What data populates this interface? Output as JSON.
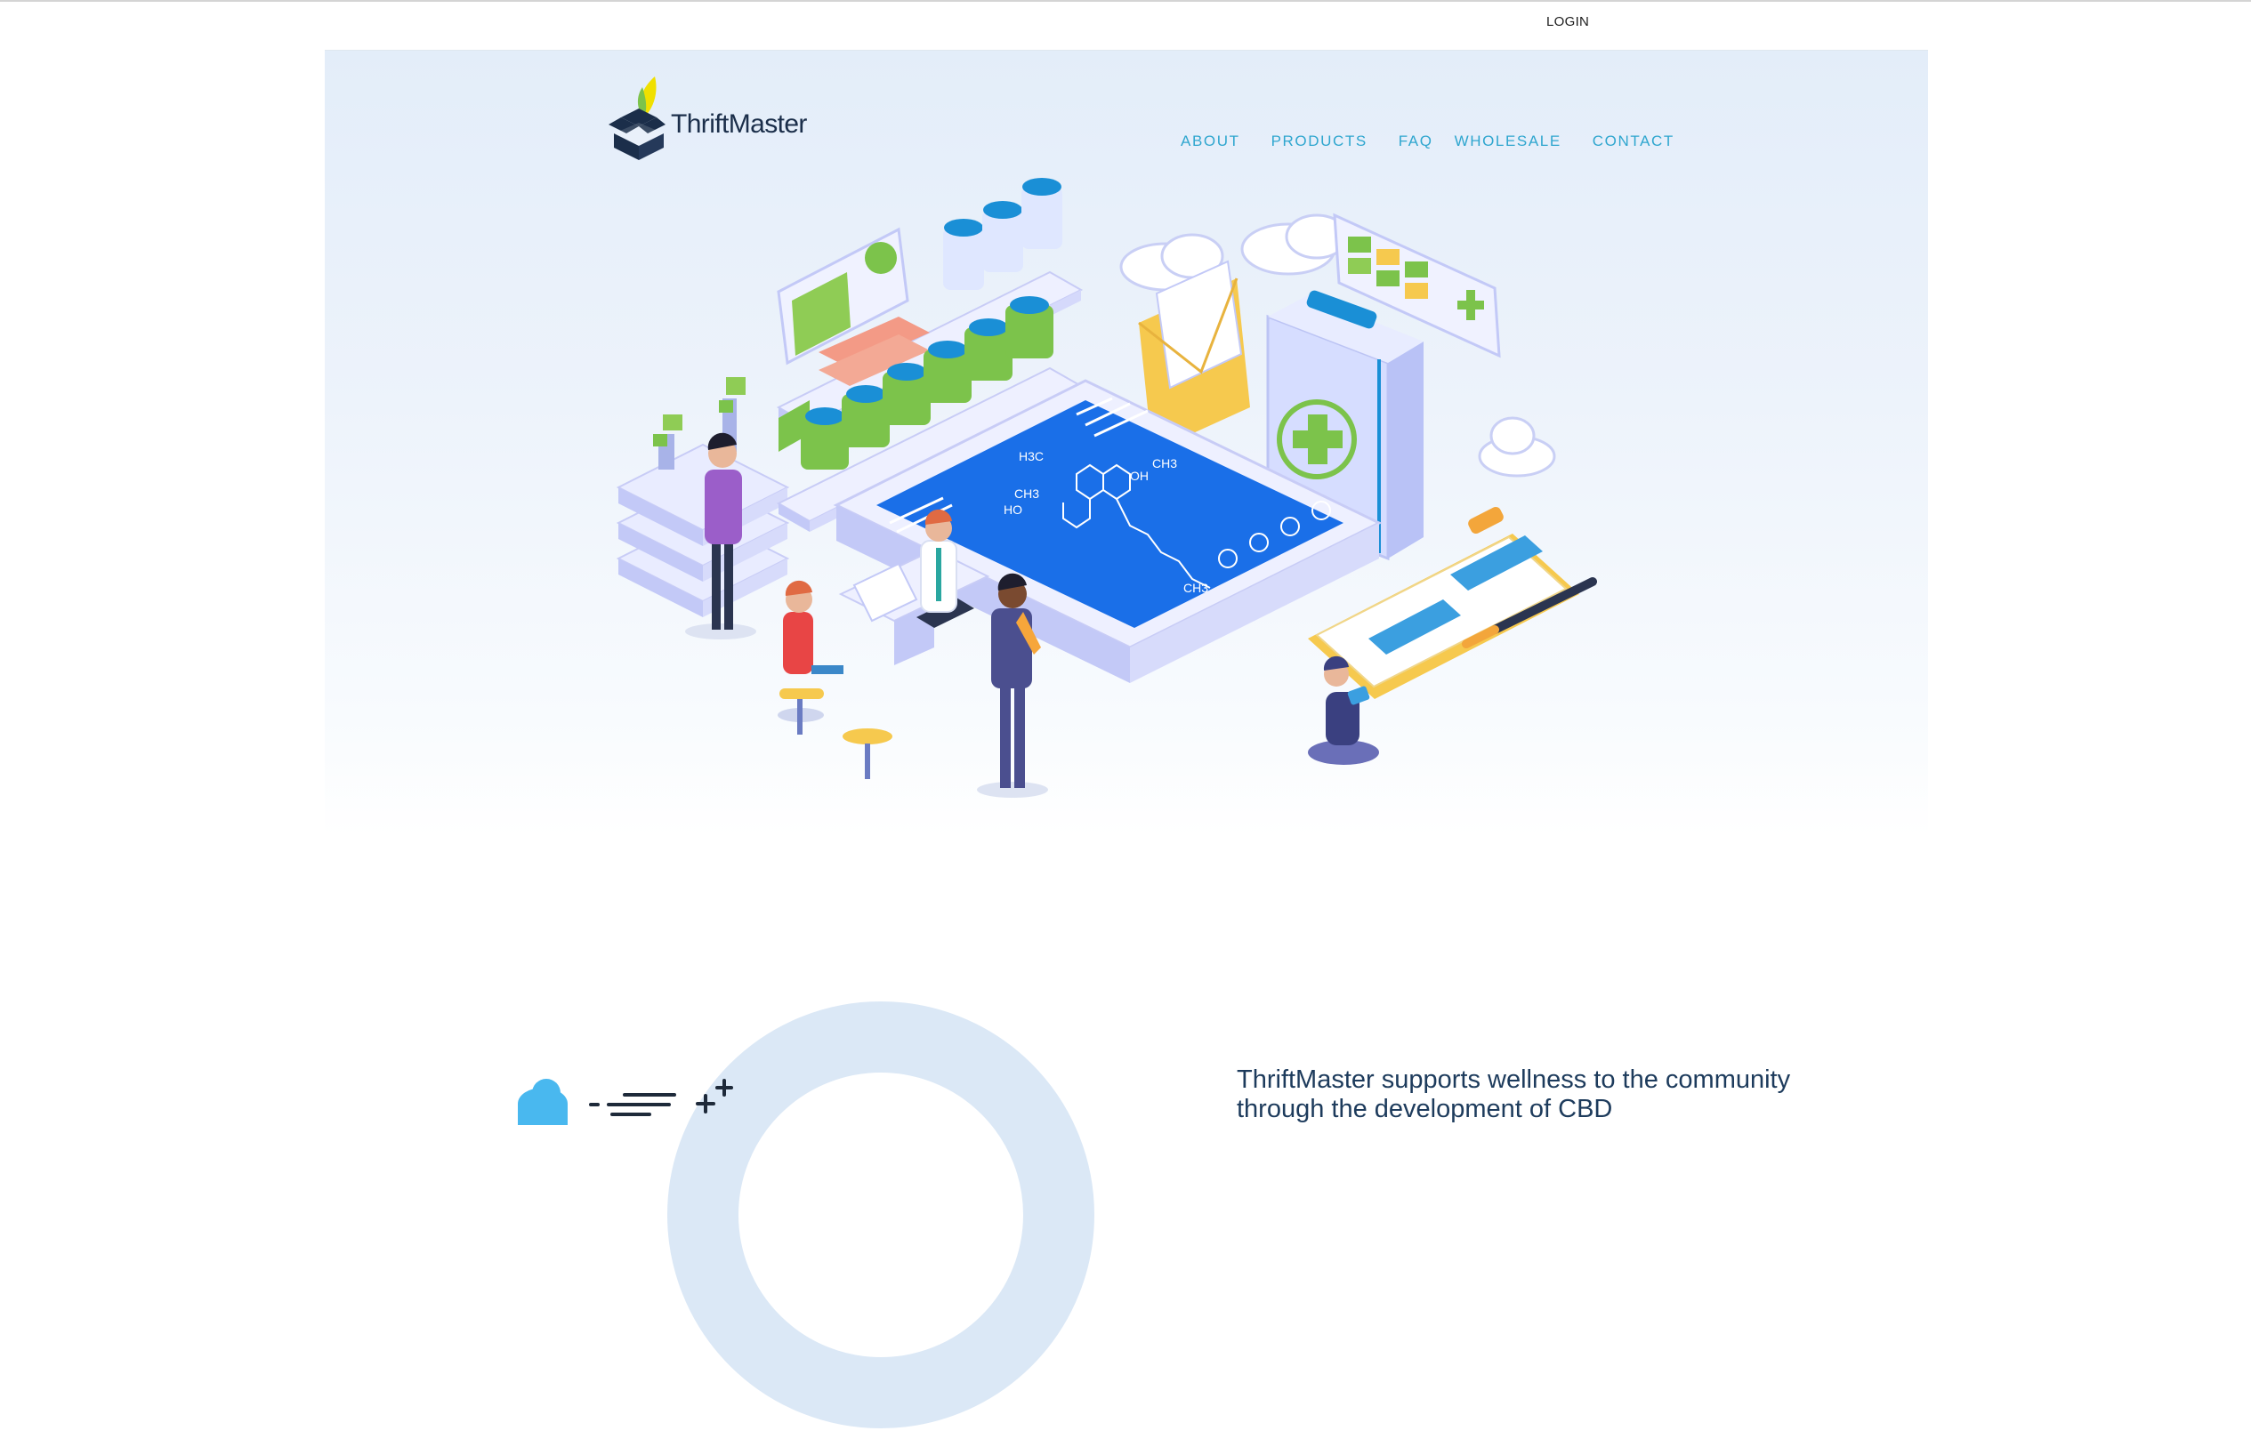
{
  "header": {
    "login_label": "LOGIN"
  },
  "brand": {
    "name": "ThriftMaster",
    "logo_icon": "box-with-leaf-icon"
  },
  "nav": {
    "items": [
      {
        "label": "ABOUT"
      },
      {
        "label": "PRODUCTS"
      },
      {
        "label": "FAQ"
      },
      {
        "label": "WHOLESALE"
      },
      {
        "label": "CONTACT"
      }
    ]
  },
  "hero": {
    "illustration": "isometric-pharmacy-lab-illustration",
    "molecule_labels": [
      "H3C",
      "CH3",
      "OH",
      "HO",
      "CH3",
      "CH3"
    ]
  },
  "intro": {
    "text": "ThriftMaster supports wellness to the community through the development of CBD"
  },
  "features": {
    "icons": [
      "cloud-icon",
      "speed-lines-icon",
      "plus-sparkle-icon"
    ]
  },
  "colors": {
    "nav": "#2fa6cf",
    "brand_text": "#1b2e4a",
    "hero_bg": "#e3edf9",
    "screen_blue": "#1a6fe8",
    "accent_green": "#7cc34b",
    "accent_yellow": "#f6c94e"
  }
}
